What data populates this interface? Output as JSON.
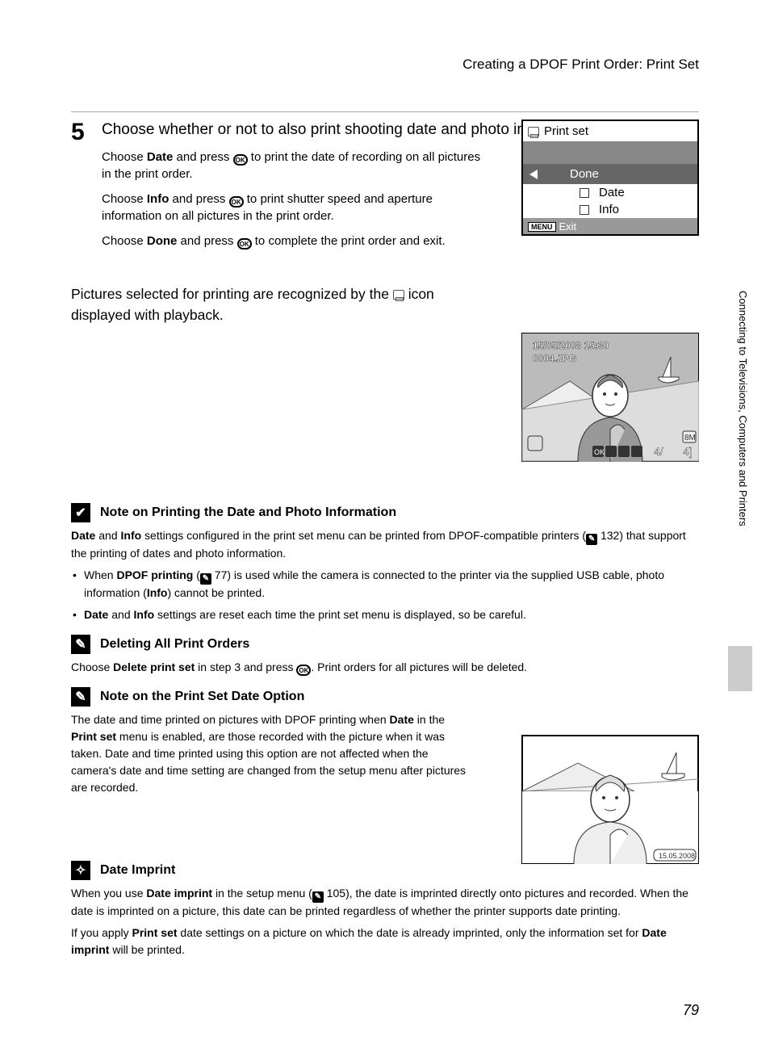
{
  "header": {
    "title": "Creating a DPOF Print Order: Print Set"
  },
  "step": {
    "number": "5",
    "title": "Choose whether or not to also print shooting date and photo information.",
    "p1a": "Choose ",
    "p1b": "Date",
    "p1c": " and press ",
    "p1d": " to print the date of recording on all pictures in the print order.",
    "p2a": "Choose ",
    "p2b": "Info",
    "p2c": " and press ",
    "p2d": " to print shutter speed and aperture information on all pictures in the print order.",
    "p3a": "Choose ",
    "p3b": "Done",
    "p3c": " and press ",
    "p3d": " to complete the print order and exit."
  },
  "lcd": {
    "title": "Print set",
    "done": "Done",
    "date": "Date",
    "info": "Info",
    "menu": "MENU",
    "exit": "Exit"
  },
  "playback": {
    "text_a": "Pictures selected for printing are recognized by the ",
    "text_b": " icon displayed with playback.",
    "overlay_date": "15/05/2008 15:30",
    "overlay_file": "0004.JPG",
    "overlay_8m": "8M",
    "overlay_4a": "4/",
    "overlay_4b": "4]"
  },
  "sidebar": {
    "text": "Connecting to Televisions, Computers and Printers"
  },
  "note1": {
    "title": "Note on Printing the Date and Photo Information",
    "p1a": "Date",
    "p1b": " and ",
    "p1c": "Info",
    "p1d": " settings configured in the print set menu can be printed from DPOF-compatible printers (",
    "p1e": " 132) that support the printing of dates and photo information.",
    "li1a": "When ",
    "li1b": "DPOF printing",
    "li1c": " (",
    "li1d": " 77) is used while the camera is connected to the printer via the supplied USB cable, photo information (",
    "li1e": "Info",
    "li1f": ") cannot be printed.",
    "li2a": "Date",
    "li2b": " and ",
    "li2c": "Info",
    "li2d": " settings are reset each time the print set menu is displayed, so be careful."
  },
  "note2": {
    "title": "Deleting All Print Orders",
    "p1a": "Choose ",
    "p1b": "Delete print set",
    "p1c": " in step 3 and press ",
    "p1d": ". Print orders for all pictures will be deleted."
  },
  "note3": {
    "title": "Note on the Print Set Date Option",
    "p1a": "The date and time printed on pictures with DPOF printing when ",
    "p1b": "Date",
    "p1c": " in the ",
    "p1d": "Print set",
    "p1e": " menu is enabled, are those recorded with the picture when it was taken. Date and time printed using this option are not affected when the camera's date and time setting are changed from the setup menu after pictures are recorded.",
    "img_date": "15.05.2008"
  },
  "note4": {
    "title": "Date Imprint",
    "p1a": "When you use ",
    "p1b": "Date imprint",
    "p1c": " in the setup menu (",
    "p1d": " 105), the date is imprinted directly onto pictures and recorded. When the date is imprinted on a picture, this date can be printed regardless of whether the printer supports date printing.",
    "p2a": "If you apply ",
    "p2b": "Print set",
    "p2c": " date settings on a picture on which the date is already imprinted, only the information set for ",
    "p2d": "Date imprint",
    "p2e": " will be printed."
  },
  "page_number": "79"
}
